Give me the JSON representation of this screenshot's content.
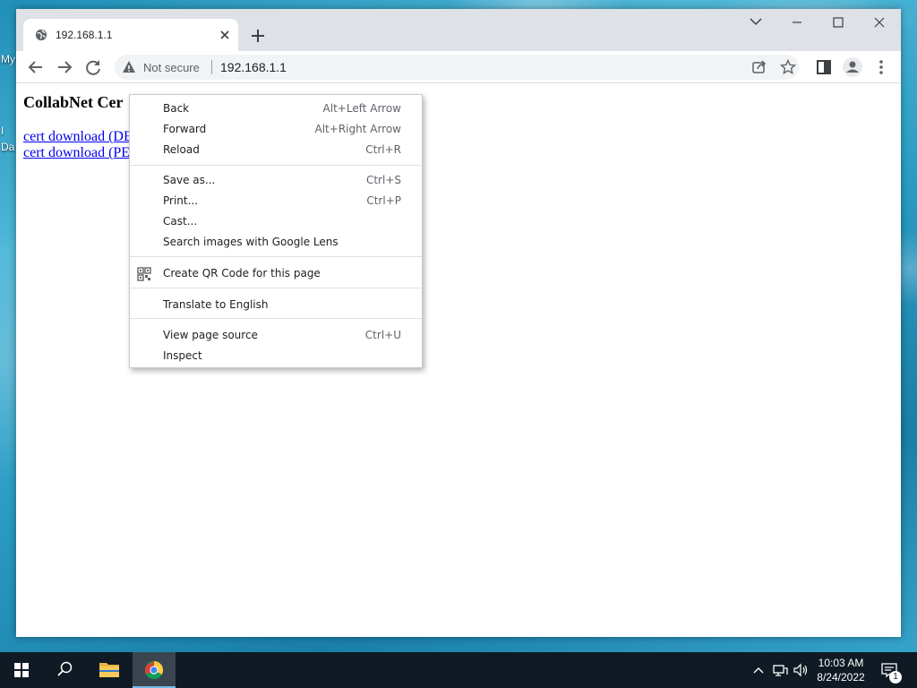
{
  "desktop": {
    "icon_labels": [
      "My",
      "I",
      "Da"
    ]
  },
  "browser": {
    "tab": {
      "title": "192.168.1.1"
    },
    "omnibox": {
      "security_label": "Not secure",
      "url": "192.168.1.1"
    }
  },
  "page": {
    "heading": "CollabNet Cer",
    "links": [
      "cert download (DE",
      "cert download (PE"
    ]
  },
  "context_menu": {
    "groups": [
      [
        {
          "label": "Back",
          "shortcut": "Alt+Left Arrow"
        },
        {
          "label": "Forward",
          "shortcut": "Alt+Right Arrow"
        },
        {
          "label": "Reload",
          "shortcut": "Ctrl+R"
        }
      ],
      [
        {
          "label": "Save as...",
          "shortcut": "Ctrl+S"
        },
        {
          "label": "Print...",
          "shortcut": "Ctrl+P"
        },
        {
          "label": "Cast...",
          "shortcut": ""
        },
        {
          "label": "Search images with Google Lens",
          "shortcut": ""
        }
      ],
      [
        {
          "label": "Create QR Code for this page",
          "shortcut": "",
          "icon": "qr-code-icon"
        }
      ],
      [
        {
          "label": "Translate to English",
          "shortcut": ""
        }
      ],
      [
        {
          "label": "View page source",
          "shortcut": "Ctrl+U"
        },
        {
          "label": "Inspect",
          "shortcut": ""
        }
      ]
    ]
  },
  "taskbar": {
    "clock": {
      "time": "10:03 AM",
      "date": "8/24/2022"
    },
    "notification_count": "1"
  },
  "colors": {
    "link": "#0000ee",
    "titlebar": "#dee1e6",
    "taskbar": "#0f1a24",
    "taskbar_active_indicator": "#76b9ed"
  }
}
